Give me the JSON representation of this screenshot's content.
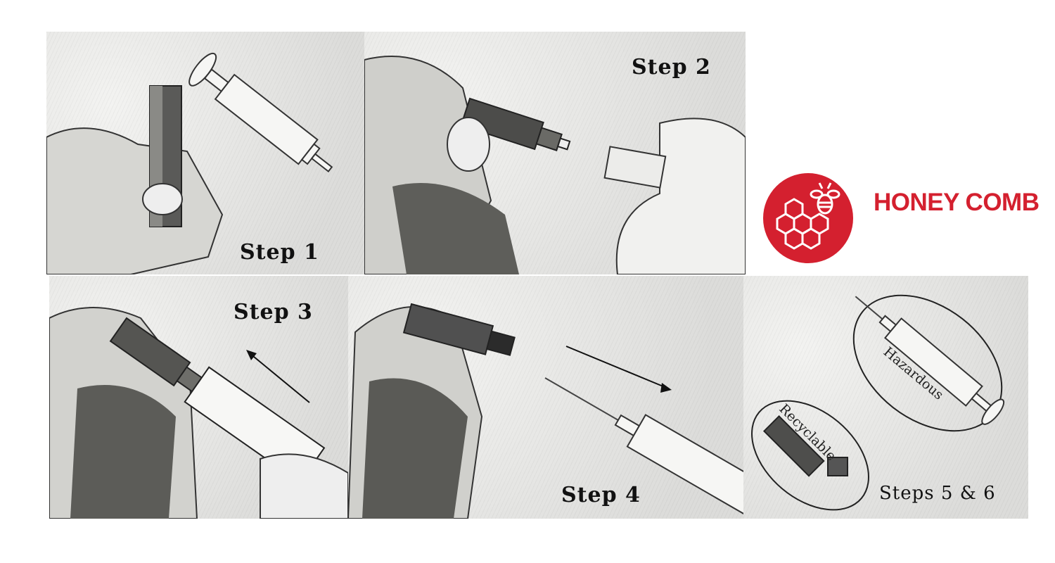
{
  "brand": {
    "name": "HONEY COMB",
    "color": "#d4202f",
    "logo_icon": "honeycomb-bee-icon"
  },
  "panels": [
    {
      "label": "Step 1"
    },
    {
      "label": "Step 2"
    },
    {
      "label": "Step 3"
    },
    {
      "label": "Step 4"
    },
    {
      "label": "Steps 5 & 6",
      "ovals": {
        "recyclable": "Recyclable",
        "hazardous": "Hazardous"
      }
    }
  ]
}
